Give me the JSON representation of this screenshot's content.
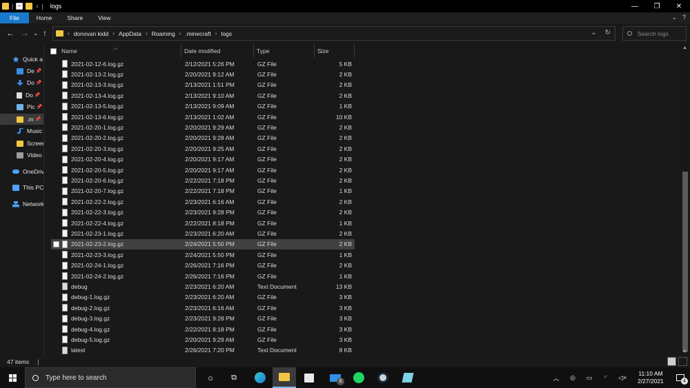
{
  "window": {
    "title": "logs",
    "controls": {
      "minimize": "—",
      "maximize": "❐",
      "close": "✕"
    }
  },
  "ribbon": {
    "tabs": [
      "File",
      "Home",
      "Share",
      "View"
    ],
    "right": {
      "collapse": "⌄",
      "help": "?"
    }
  },
  "nav": {
    "back": "←",
    "forward": "→",
    "recent": "⌄",
    "up": "↑"
  },
  "address": {
    "crumbs": [
      "donovan kidd",
      "AppData",
      "Roaming",
      ".minecraft",
      "logs"
    ],
    "separator": "›",
    "history_icon": "⌄",
    "refresh_icon": "↻"
  },
  "search": {
    "placeholder": "Search logs"
  },
  "sidebar": {
    "items": [
      {
        "label": "Quick a",
        "icon": "star-icon",
        "color": "#4da3ff",
        "pinned": false
      },
      {
        "label": "De",
        "icon": "desktop-folder-icon",
        "color": "#3a8ee6",
        "pinned": true
      },
      {
        "label": "Do",
        "icon": "downloads-icon",
        "color": "#3a8ee6",
        "pinned": true
      },
      {
        "label": "Do",
        "icon": "documents-icon",
        "color": "#dcdcdc",
        "pinned": true
      },
      {
        "label": "Pic",
        "icon": "pictures-icon",
        "color": "#6fb3e8",
        "pinned": true
      },
      {
        "label": ".m",
        "icon": "folder-icon",
        "color": "#f2c744",
        "pinned": true,
        "selected": true
      },
      {
        "label": "Music",
        "icon": "music-icon",
        "color": "#3a8ee6",
        "pinned": false
      },
      {
        "label": "Screen",
        "icon": "folder-icon",
        "color": "#f2c744",
        "pinned": false
      },
      {
        "label": "Video",
        "icon": "videos-icon",
        "color": "#9a9a9a",
        "pinned": false
      },
      {
        "label": "OneDriv",
        "icon": "onedrive-icon",
        "color": "#4da3ff",
        "pinned": false
      },
      {
        "label": "This PC",
        "icon": "computer-icon",
        "color": "#4da3ff",
        "pinned": false
      },
      {
        "label": "Network",
        "icon": "network-icon",
        "color": "#4da3ff",
        "pinned": false
      }
    ]
  },
  "table": {
    "columns": {
      "name": "Name",
      "date": "Date modified",
      "type": "Type",
      "size": "Size"
    },
    "rows": [
      {
        "name": "2021-02-12-6.log.gz",
        "date": "2/12/2021 5:26 PM",
        "type": "GZ File",
        "size": "5 KB"
      },
      {
        "name": "2021-02-13-2.log.gz",
        "date": "2/20/2021 9:12 AM",
        "type": "GZ File",
        "size": "2 KB"
      },
      {
        "name": "2021-02-13-3.log.gz",
        "date": "2/13/2021 1:51 PM",
        "type": "GZ File",
        "size": "2 KB"
      },
      {
        "name": "2021-02-13-4.log.gz",
        "date": "2/13/2021 9:10 AM",
        "type": "GZ File",
        "size": "2 KB"
      },
      {
        "name": "2021-02-13-5.log.gz",
        "date": "2/13/2021 9:09 AM",
        "type": "GZ File",
        "size": "1 KB"
      },
      {
        "name": "2021-02-13-6.log.gz",
        "date": "2/13/2021 1:02 AM",
        "type": "GZ File",
        "size": "10 KB"
      },
      {
        "name": "2021-02-20-1.log.gz",
        "date": "2/20/2021 9:29 AM",
        "type": "GZ File",
        "size": "2 KB"
      },
      {
        "name": "2021-02-20-2.log.gz",
        "date": "2/20/2021 9:28 AM",
        "type": "GZ File",
        "size": "2 KB"
      },
      {
        "name": "2021-02-20-3.log.gz",
        "date": "2/20/2021 9:25 AM",
        "type": "GZ File",
        "size": "2 KB"
      },
      {
        "name": "2021-02-20-4.log.gz",
        "date": "2/20/2021 9:17 AM",
        "type": "GZ File",
        "size": "2 KB"
      },
      {
        "name": "2021-02-20-5.log.gz",
        "date": "2/20/2021 9:17 AM",
        "type": "GZ File",
        "size": "2 KB"
      },
      {
        "name": "2021-02-20-6.log.gz",
        "date": "2/22/2021 7:18 PM",
        "type": "GZ File",
        "size": "2 KB"
      },
      {
        "name": "2021-02-20-7.log.gz",
        "date": "2/22/2021 7:18 PM",
        "type": "GZ File",
        "size": "1 KB"
      },
      {
        "name": "2021-02-22-2.log.gz",
        "date": "2/23/2021 6:16 AM",
        "type": "GZ File",
        "size": "2 KB"
      },
      {
        "name": "2021-02-22-3.log.gz",
        "date": "2/23/2021 9:28 PM",
        "type": "GZ File",
        "size": "2 KB"
      },
      {
        "name": "2021-02-22-4.log.gz",
        "date": "2/22/2021 8:18 PM",
        "type": "GZ File",
        "size": "1 KB"
      },
      {
        "name": "2021-02-23-1.log.gz",
        "date": "2/23/2021 6:20 AM",
        "type": "GZ File",
        "size": "2 KB"
      },
      {
        "name": "2021-02-23-2.log.gz",
        "date": "2/24/2021 5:50 PM",
        "type": "GZ File",
        "size": "2 KB",
        "selected": true
      },
      {
        "name": "2021-02-23-3.log.gz",
        "date": "2/24/2021 5:50 PM",
        "type": "GZ File",
        "size": "1 KB"
      },
      {
        "name": "2021-02-24-1.log.gz",
        "date": "2/26/2021 7:16 PM",
        "type": "GZ File",
        "size": "2 KB"
      },
      {
        "name": "2021-02-24-2.log.gz",
        "date": "2/26/2021 7:16 PM",
        "type": "GZ File",
        "size": "1 KB"
      },
      {
        "name": "debug",
        "date": "2/23/2021 6:20 AM",
        "type": "Text Document",
        "size": "13 KB",
        "text": true
      },
      {
        "name": "debug-1.log.gz",
        "date": "2/23/2021 6:20 AM",
        "type": "GZ File",
        "size": "3 KB"
      },
      {
        "name": "debug-2.log.gz",
        "date": "2/23/2021 6:16 AM",
        "type": "GZ File",
        "size": "3 KB"
      },
      {
        "name": "debug-3.log.gz",
        "date": "2/23/2021 9:28 PM",
        "type": "GZ File",
        "size": "3 KB"
      },
      {
        "name": "debug-4.log.gz",
        "date": "2/22/2021 8:18 PM",
        "type": "GZ File",
        "size": "3 KB"
      },
      {
        "name": "debug-5.log.gz",
        "date": "2/20/2021 9:29 AM",
        "type": "GZ File",
        "size": "3 KB"
      },
      {
        "name": "latest",
        "date": "2/26/2021 7:20 PM",
        "type": "Text Document",
        "size": "8 KB",
        "text": true
      }
    ]
  },
  "status": {
    "items_count": "47 items",
    "separator": "|"
  },
  "taskbar": {
    "search_placeholder": "Type here to search",
    "mail_badge": "5",
    "time": "11:10 AM",
    "date": "2/27/2021",
    "notification_count": "4",
    "tray_chevron": "︿"
  },
  "colors": {
    "accent": "#1979ca",
    "folder": "#f2c744",
    "selection": "#414141"
  }
}
